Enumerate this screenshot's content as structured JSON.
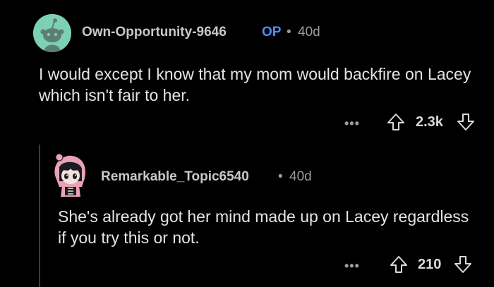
{
  "comments": [
    {
      "username": "Own-Opportunity-9646",
      "badge": "OP",
      "separator": "•",
      "age": "40d",
      "text": "I would except I know that my mom would backfire on Lacey which isn't fair to her.",
      "more": "•••",
      "score": "2.3k"
    },
    {
      "username": "Remarkable_Topic6540",
      "separator": "•",
      "age": "40d",
      "text": "She's already got her mind made up on Lacey regardless if you try this or not.",
      "more": "•••",
      "score": "210"
    }
  ],
  "colors": {
    "background": "#000000",
    "avatar_bg": "#7ed0b3",
    "op_badge": "#4f8ff7",
    "text": "#e2e4e6",
    "meta": "#9a9c9e"
  },
  "icons": [
    "snoo-avatar-icon",
    "anime-avatar-icon",
    "more-options-icon",
    "upvote-icon",
    "downvote-icon"
  ]
}
